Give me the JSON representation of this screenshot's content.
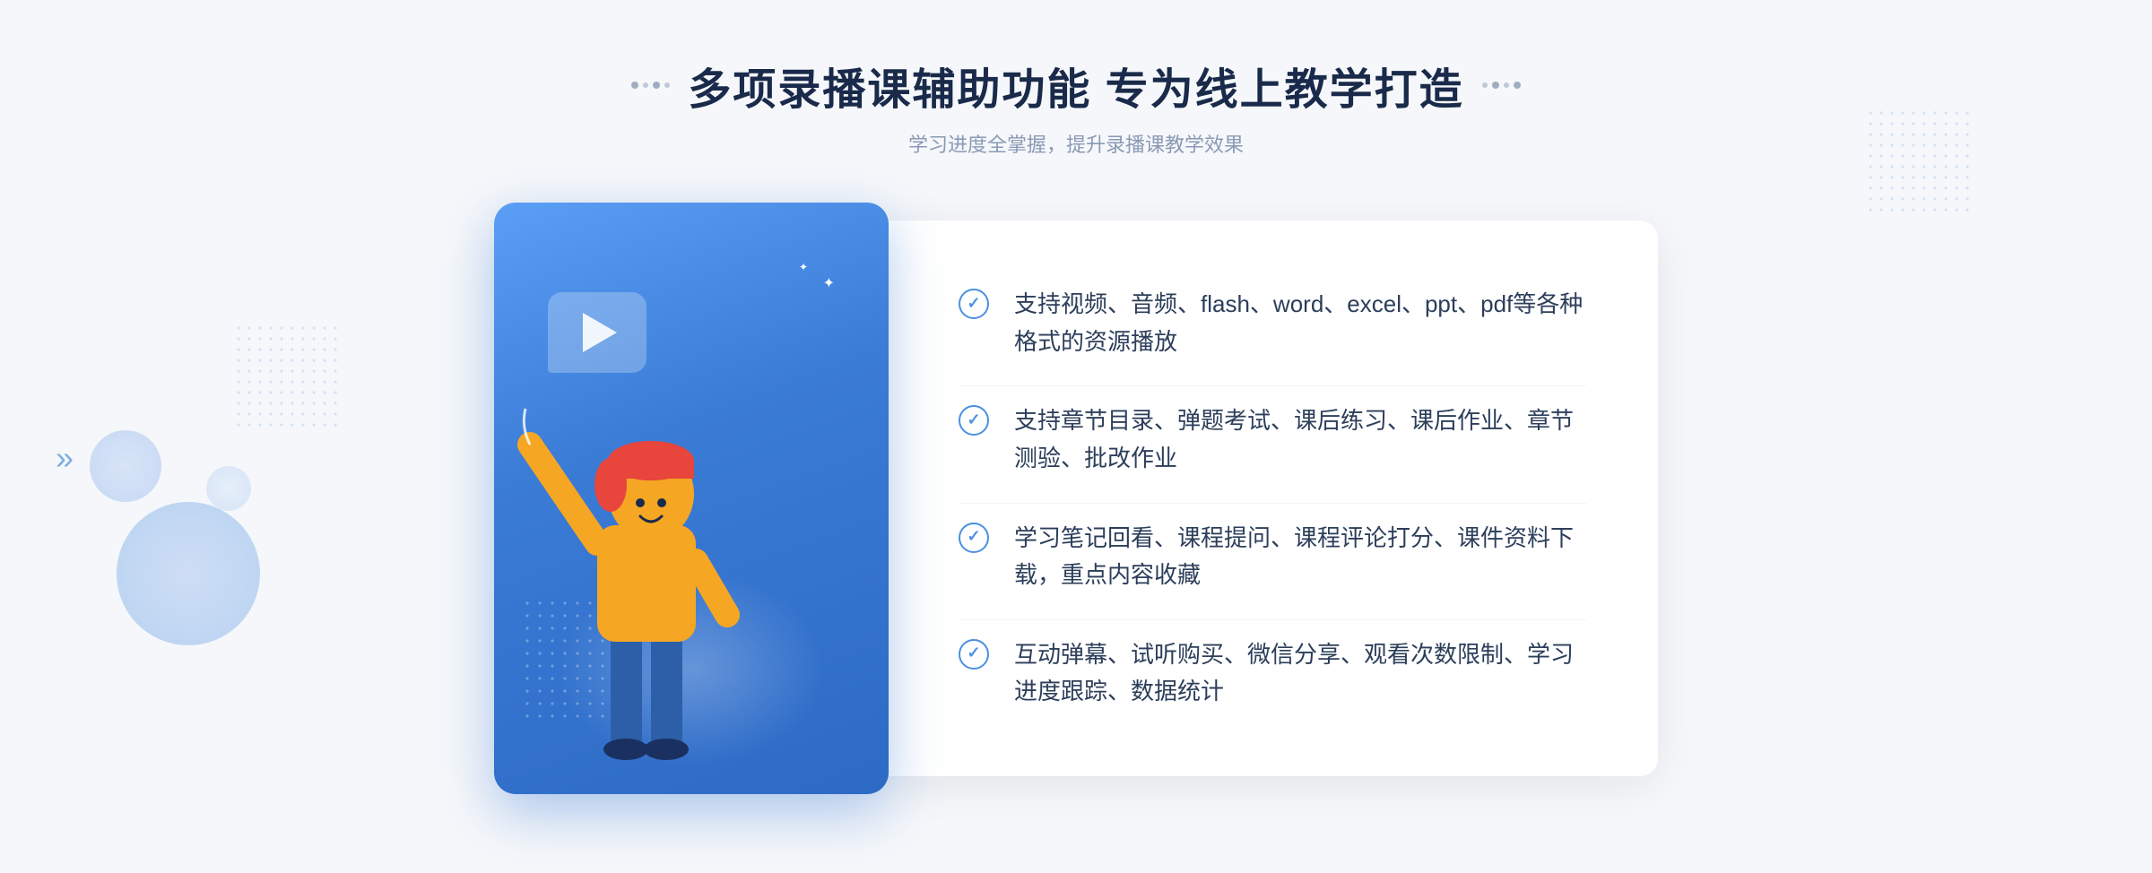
{
  "header": {
    "title": "多项录播课辅助功能 专为线上教学打造",
    "subtitle": "学习进度全掌握，提升录播课教学效果",
    "deco_left": "❖",
    "deco_right": "❖"
  },
  "features": [
    {
      "id": 1,
      "text": "支持视频、音频、flash、word、excel、ppt、pdf等各种格式的资源播放"
    },
    {
      "id": 2,
      "text": "支持章节目录、弹题考试、课后练习、课后作业、章节测验、批改作业"
    },
    {
      "id": 3,
      "text": "学习笔记回看、课程提问、课程评论打分、课件资料下载，重点内容收藏"
    },
    {
      "id": 4,
      "text": "互动弹幕、试听购买、微信分享、观看次数限制、学习进度跟踪、数据统计"
    }
  ],
  "illustration": {
    "play_button_alt": "play button",
    "card_background": "#4a90d9"
  },
  "colors": {
    "primary_blue": "#4a90e2",
    "dark_blue": "#1a2a4a",
    "light_gray": "#8a9ab5",
    "white": "#ffffff"
  }
}
